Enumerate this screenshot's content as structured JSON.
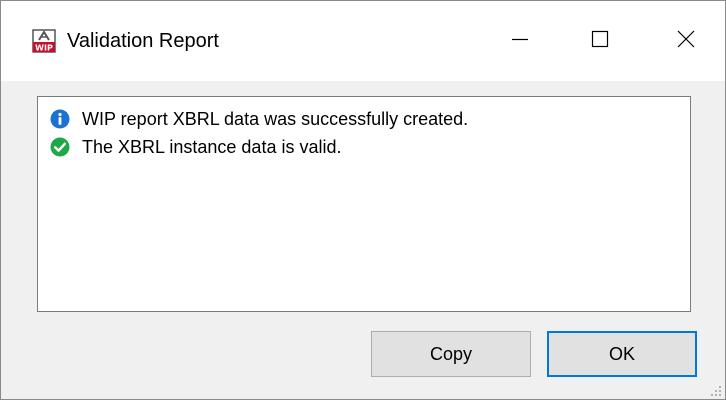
{
  "window": {
    "title": "Validation Report",
    "app_icon": "wip-app-icon",
    "controls": {
      "minimize_icon": "minimize-icon",
      "maximize_icon": "maximize-icon",
      "close_icon": "close-icon"
    }
  },
  "messages": [
    {
      "icon": "info-icon",
      "icon_color": "#1a73d0",
      "text": "WIP report XBRL data was successfully created."
    },
    {
      "icon": "check-circle-icon",
      "icon_color": "#1fa84a",
      "text": "The XBRL instance data is valid."
    }
  ],
  "buttons": {
    "copy_label": "Copy",
    "ok_label": "OK"
  },
  "colors": {
    "accent": "#0078d7",
    "dialog_bg": "#f0f0f0",
    "button_bg": "#e1e1e1"
  }
}
